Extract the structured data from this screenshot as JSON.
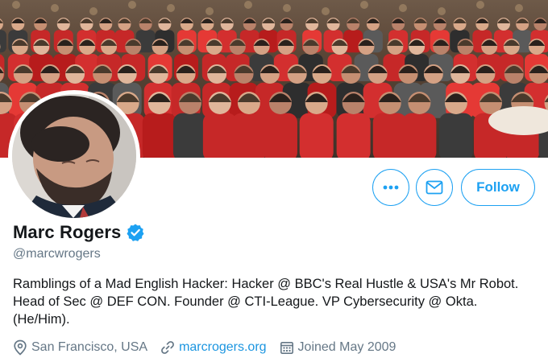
{
  "profile": {
    "display_name": "Marc Rogers",
    "handle": "@marcwrogers",
    "verified": true,
    "bio_lines": [
      "Ramblings of a Mad English Hacker: Hacker @ BBC's Real Hustle & USA's Mr Robot.",
      "Head of Sec @ DEF CON. Founder @ CTI-League. VP Cybersecurity @ Okta.",
      "(He/Him)."
    ],
    "location": "San Francisco, USA",
    "website": "marcrogers.org",
    "joined": "Joined May 2009"
  },
  "actions": {
    "more_label": "•••",
    "follow_label": "Follow"
  },
  "colors": {
    "accent": "#1da1f2",
    "link": "#1b95e0",
    "secondary_text": "#657786",
    "banner_shirt_red": "#c62828"
  },
  "icons": {
    "more": "more-icon",
    "message": "envelope-icon",
    "verified": "verified-badge-icon",
    "location": "location-pin-icon",
    "link": "link-icon",
    "calendar": "calendar-icon"
  }
}
